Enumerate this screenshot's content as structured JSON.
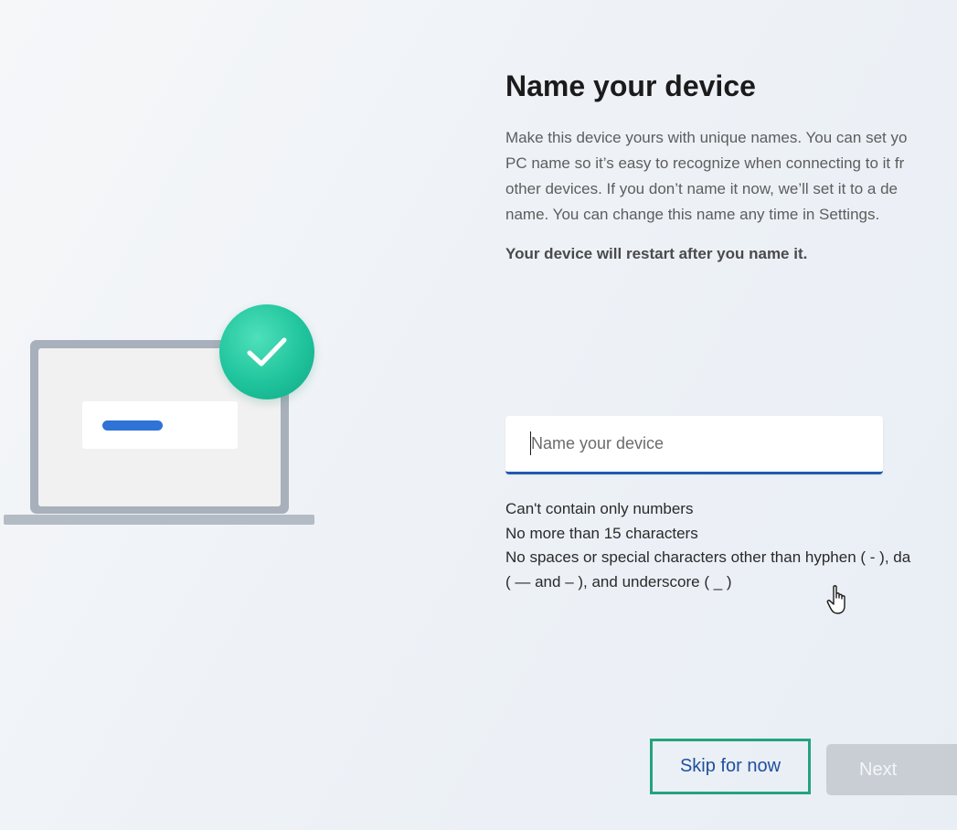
{
  "page": {
    "title": "Name your device",
    "description_lines": [
      "Make this device yours with unique names. You can set yo",
      "PC name so it’s easy to recognize when connecting to it fr",
      "other devices. If you don’t name it now, we’ll set it to a de",
      "name. You can change this name any time in Settings."
    ],
    "restart_note": "Your device will restart after you name it."
  },
  "input": {
    "placeholder": "Name your device",
    "value": ""
  },
  "rules": [
    "Can't contain only numbers",
    "No more than 15 characters",
    "No spaces or special characters other than hyphen ( - ), da",
    "( — and – ), and underscore ( _ )"
  ],
  "buttons": {
    "skip_label": "Skip for now",
    "next_label": "Next"
  },
  "colors": {
    "accent": "#1f5bb0",
    "check_badge": "#1fc49c",
    "highlight_border": "#24a37d",
    "next_disabled": "#c9ced5"
  },
  "icons": {
    "illustration": "laptop-with-checkmark",
    "cursor": "hand-pointer"
  }
}
